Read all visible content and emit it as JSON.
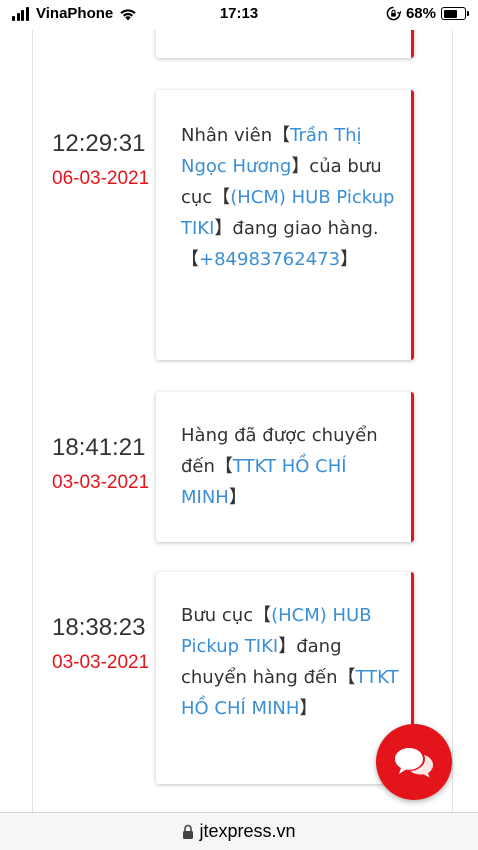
{
  "status_bar": {
    "carrier": "VinaPhone",
    "time": "17:13",
    "battery": "68%",
    "battery_level": 0.68
  },
  "timeline": [
    {
      "time": "12:29:31",
      "date": "06-03-2021",
      "message": [
        {
          "text": "Nhân viên【",
          "link": false
        },
        {
          "text": "Trần Thị Ngọc Hương",
          "link": true
        },
        {
          "text": "】của bưu cục【",
          "link": false
        },
        {
          "text": "(HCM) HUB Pickup TIKI",
          "link": true
        },
        {
          "text": "】đang giao hàng.【",
          "link": false
        },
        {
          "text": "+84983762473",
          "link": true
        },
        {
          "text": "】",
          "link": false
        }
      ]
    },
    {
      "time": "18:41:21",
      "date": "03-03-2021",
      "message": [
        {
          "text": "Hàng đã được chuyển đến【",
          "link": false
        },
        {
          "text": "TTKT HỒ CHÍ MINH",
          "link": true
        },
        {
          "text": "】",
          "link": false
        }
      ]
    },
    {
      "time": "18:38:23",
      "date": "03-03-2021",
      "message": [
        {
          "text": "Bưu cục【",
          "link": false
        },
        {
          "text": "(HCM) HUB Pickup TIKI",
          "link": true
        },
        {
          "text": "】đang chuyển hàng đến【",
          "link": false
        },
        {
          "text": "TTKT HỒ CHÍ MINH",
          "link": true
        },
        {
          "text": "】",
          "link": false
        }
      ]
    }
  ],
  "url_bar": {
    "url": "jtexpress.vn"
  },
  "icons": {
    "chat": "chat-bubbles-icon",
    "padlock": "padlock-icon",
    "wifi": "wifi-icon",
    "orientation_lock": "orientation-lock-icon"
  },
  "colors": {
    "accent_red": "#e3151a",
    "link_blue": "#3a8fd6",
    "text": "#333333"
  }
}
